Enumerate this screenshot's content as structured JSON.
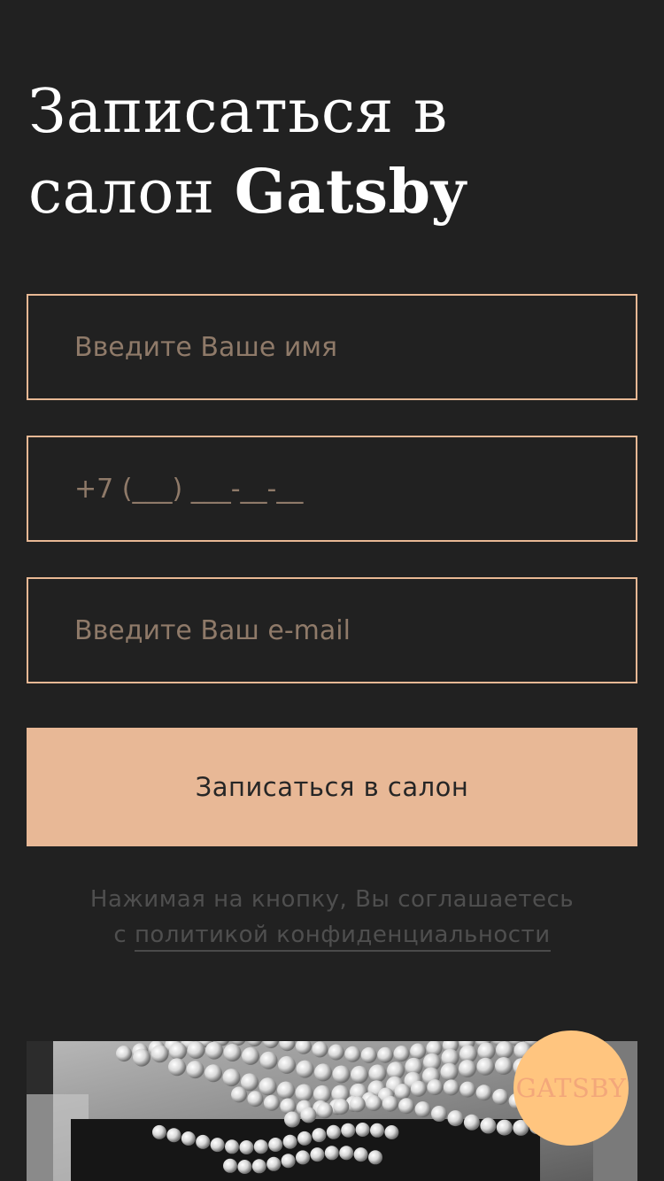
{
  "form": {
    "title_line1": "Записаться в",
    "title_line2_prefix": "салон",
    "title_brand": "Gatsby",
    "name_placeholder": "Введите Ваше имя",
    "phone_placeholder": "+7 (___) ___-__-__",
    "email_placeholder": "Введите Ваш e-mail",
    "submit_label": "Записаться в салон",
    "consent_text": "Нажимая на кнопку, Вы соглашаетесь",
    "consent_prefix": "с",
    "consent_link": "политикой конфиденциальности"
  },
  "photo": {
    "icon": "pearl-necklace-photo"
  },
  "badge": {
    "label": "GATSBY"
  },
  "colors": {
    "background": "#212121",
    "accent": "#e8b896",
    "badge": "#ffc57f"
  }
}
